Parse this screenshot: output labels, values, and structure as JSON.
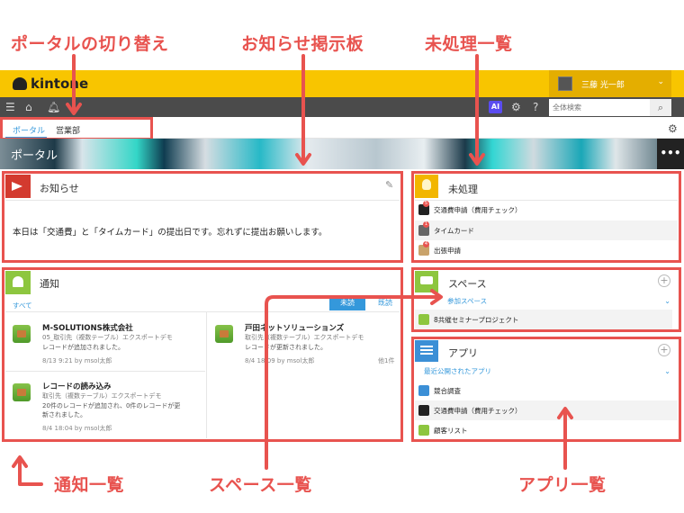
{
  "callouts": {
    "portal_switch": "ポータルの切り替え",
    "notice_board": "お知らせ掲示板",
    "unprocessed_list": "未処理一覧",
    "notification_list": "通知一覧",
    "space_list": "スペース一覧",
    "app_list": "アプリ一覧"
  },
  "header": {
    "logo": "kintone",
    "user_name": "三藤 光一郎",
    "ai_label": "AI",
    "search_placeholder": "全体検索"
  },
  "tabs": [
    "ポータル",
    "営業部"
  ],
  "banner": {
    "title": "ポータル",
    "menu": "•••"
  },
  "notice": {
    "title": "お知らせ",
    "body": "本日は「交通費」と「タイムカード」の提出日です。忘れずに提出お願いします。"
  },
  "notifications": {
    "title": "通知",
    "filter": "すべて",
    "tab_unread": "未読",
    "tab_read": "既読",
    "items": [
      {
        "title": "M-SOLUTIONS株式会社",
        "sub": "05_取引先（複数テーブル）エクスポートデモ",
        "body": "レコードが追加されました。",
        "meta": "8/13 9:21  by msol太郎"
      },
      {
        "title": "戸田ネットソリューションズ",
        "sub": "取引先（複数テーブル）エクスポートデモ",
        "body": "レコードが更新されました。",
        "meta": "8/4 18:09  by msol太郎",
        "extra": "他1件"
      },
      {
        "title": "レコードの読み込み",
        "sub": "取引先（複数テーブル）エクスポートデモ",
        "body": "20件のレコードが追加され、0件のレコードが更新されました。",
        "meta": "8/4 18:04  by msol太郎"
      }
    ]
  },
  "unprocessed": {
    "title": "未処理",
    "items": [
      {
        "label": "交通費申請（費用チェック）",
        "badge": "5"
      },
      {
        "label": "タイムカード",
        "badge": "1"
      },
      {
        "label": "出張申請",
        "badge": "4"
      }
    ]
  },
  "spaces": {
    "title": "スペース",
    "dropdown": "参加スペース",
    "items": [
      {
        "label": "8共催セミナープロジェクト"
      }
    ]
  },
  "apps": {
    "title": "アプリ",
    "dropdown": "最近公開されたアプリ",
    "items": [
      {
        "label": "競合調査"
      },
      {
        "label": "交通費申請（費用チェック）"
      },
      {
        "label": "顧客リスト"
      }
    ]
  },
  "colors": {
    "accent": "#e8534f",
    "header": "#f8c500",
    "link": "#3498db",
    "nav": "#4b4b4b"
  }
}
